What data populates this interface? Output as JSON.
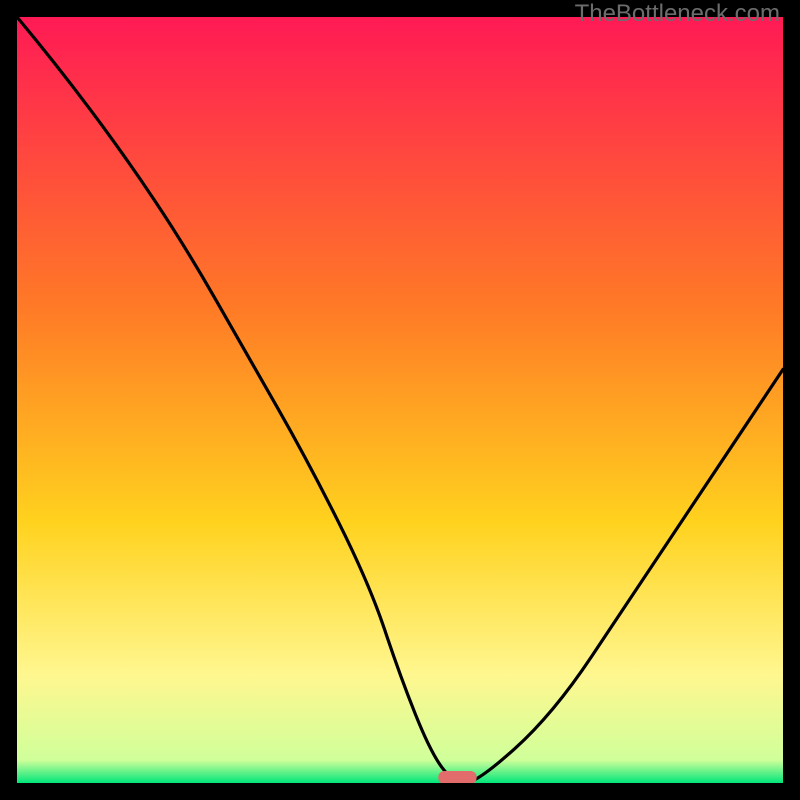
{
  "attribution": "TheBottleneck.com",
  "colors": {
    "black": "#000000",
    "gradient_top": "#ff1a55",
    "gradient_mid1": "#ff7a26",
    "gradient_mid2": "#ffd21e",
    "gradient_mid3": "#fff790",
    "gradient_bottom": "#00e67a",
    "curve": "#000000",
    "marker": "#e26b6b"
  },
  "chart_data": {
    "type": "line",
    "title": "",
    "xlabel": "",
    "ylabel": "",
    "xlim": [
      0,
      100
    ],
    "ylim": [
      0,
      100
    ],
    "series": [
      {
        "name": "bottleneck-curve",
        "x": [
          0,
          5,
          14,
          22,
          30,
          38,
          46,
          50,
          54,
          57,
          60,
          70,
          80,
          90,
          100
        ],
        "values": [
          100,
          94,
          82,
          70,
          56,
          42,
          26,
          14,
          4,
          0,
          0,
          9,
          24,
          39,
          54
        ]
      }
    ],
    "marker": {
      "x_start": 55,
      "x_end": 60,
      "y": 0
    }
  }
}
